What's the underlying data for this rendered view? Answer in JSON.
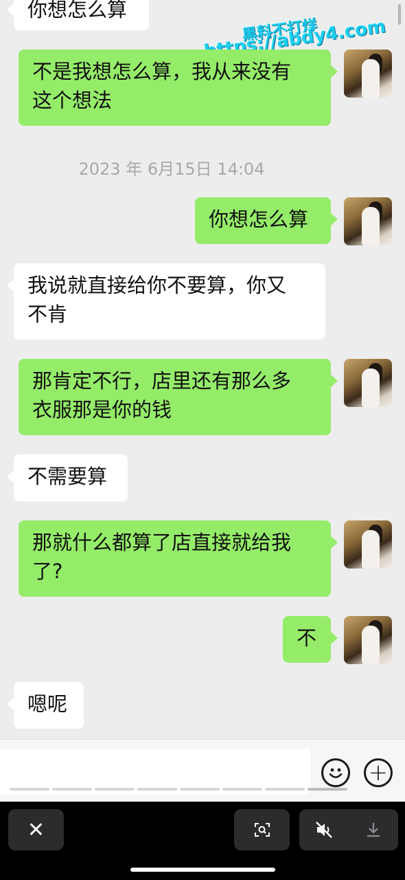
{
  "watermark": {
    "line1": "黑料不打烊",
    "line2": "https://abdy4.com"
  },
  "messages": [
    {
      "side": "in",
      "text": "你想怎么算"
    },
    {
      "side": "out",
      "text": "不是我想怎么算，我从来没有\n这个想法"
    },
    {
      "side": "out",
      "text": "你想怎么算"
    },
    {
      "side": "in",
      "text": "我说就直接给你不要算，你又\n不肯"
    },
    {
      "side": "out",
      "text": "那肯定不行，店里还有那么多\n衣服那是你的钱"
    },
    {
      "side": "in",
      "text": "不需要算"
    },
    {
      "side": "out",
      "text": "那就什么都算了店直接就给我\n了?"
    },
    {
      "side": "out",
      "text": "不"
    },
    {
      "side": "in",
      "text": "嗯呢"
    }
  ],
  "timestamp": "2023 年 6月15日 14:04",
  "input": {
    "emoji_icon": "emoji-smile-icon",
    "plus_label": "+"
  },
  "viewer_bar": {
    "close_label": "✕",
    "scan_icon": "scan-icon",
    "mute_icon": "speaker-muted-icon",
    "download_icon": "download-icon"
  },
  "colors": {
    "outgoing_bubble": "#95ec69",
    "incoming_bubble": "#ffffff",
    "background": "#ededed",
    "viewer_bar": "#000000"
  }
}
